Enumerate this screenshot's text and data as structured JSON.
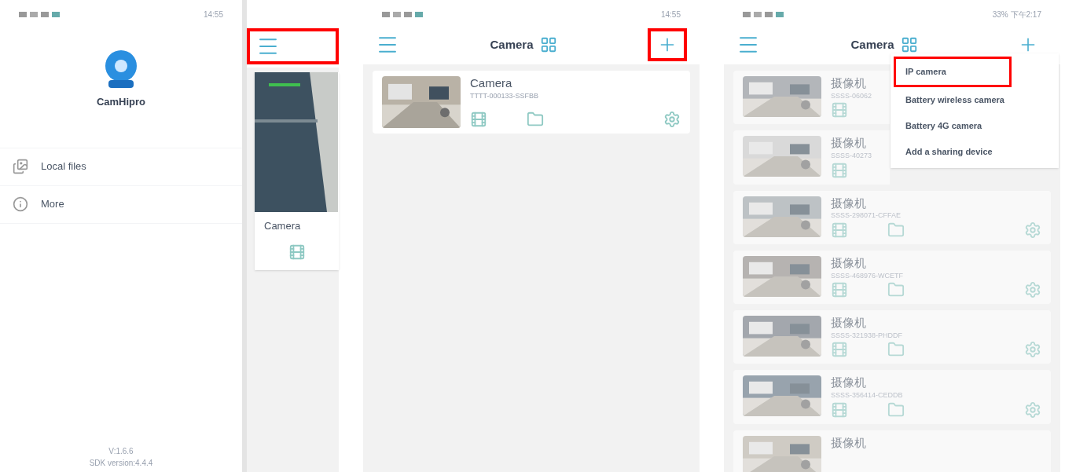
{
  "screens": [
    {
      "kind": "drawer",
      "time": "14:55",
      "app_name": "CamHipro",
      "items": [
        {
          "label": "Local files"
        },
        {
          "label": "More"
        }
      ],
      "version": "V:1.6.6",
      "sdk_version": "SDK version:4.4.4",
      "behind": {
        "menu_highlighted": true,
        "card_title": "Camera"
      }
    },
    {
      "kind": "list",
      "time": "14:55",
      "title": "Camera",
      "add_highlighted": true,
      "devices": [
        {
          "name": "Camera",
          "uid": "TTTT-000133-SSFBB",
          "settings": true
        }
      ]
    },
    {
      "kind": "list",
      "time": "33% 下午2:17",
      "title": "Camera",
      "add_highlighted": false,
      "faded": true,
      "devices": [
        {
          "name": "摄像机",
          "uid": "SSSS-06062",
          "settings": false
        },
        {
          "name": "摄像机",
          "uid": "SSSS-40273",
          "settings": false
        },
        {
          "name": "摄像机",
          "uid": "SSSS-298071-CFFAE",
          "settings": true
        },
        {
          "name": "摄像机",
          "uid": "SSSS-468976-WCETF",
          "settings": true
        },
        {
          "name": "摄像机",
          "uid": "SSSS-321938-PHDDF",
          "settings": true
        },
        {
          "name": "摄像机",
          "uid": "SSSS-356414-CEDDB",
          "settings": true
        },
        {
          "name": "摄像机"
        }
      ],
      "menu": [
        {
          "label": "IP camera",
          "highlighted": true
        },
        {
          "label": "Battery wireless camera",
          "highlighted": false
        },
        {
          "label": "Battery 4G camera",
          "highlighted": false
        },
        {
          "label": "Add a sharing device",
          "highlighted": false
        }
      ]
    }
  ]
}
